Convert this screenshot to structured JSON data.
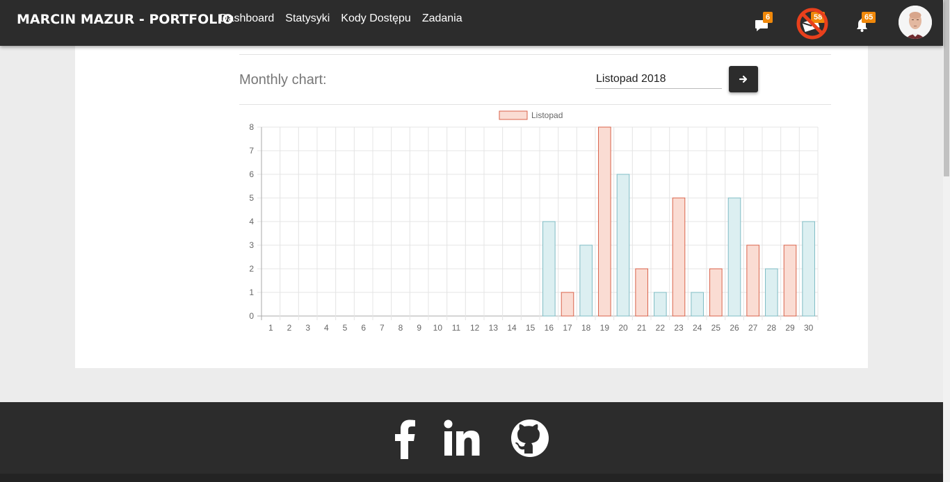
{
  "navbar": {
    "brand": "MARCIN MAZUR - PORTFOLIO",
    "links": [
      "Dashboard",
      "Statysyki",
      "Kody Dostępu",
      "Zadania"
    ],
    "messages_badge": "6",
    "mail_badge": "58",
    "notifications_badge": "65",
    "badge_color": "#f0880a"
  },
  "content": {
    "section_title": "Monthly chart:",
    "month_value": "Listopad 2018",
    "go_button_icon": "arrow-right-icon"
  },
  "chart_data": {
    "type": "bar",
    "title": "",
    "legend": "Listopad",
    "legend_position": "top",
    "categories": [
      "1",
      "2",
      "3",
      "4",
      "5",
      "6",
      "7",
      "8",
      "9",
      "10",
      "11",
      "12",
      "13",
      "14",
      "15",
      "16",
      "17",
      "18",
      "19",
      "20",
      "21",
      "22",
      "23",
      "24",
      "25",
      "26",
      "27",
      "28",
      "29",
      "30"
    ],
    "values": [
      0,
      0,
      0,
      0,
      0,
      0,
      0,
      0,
      0,
      0,
      0,
      0,
      0,
      0,
      0,
      4,
      1,
      3,
      8,
      6,
      2,
      1,
      5,
      1,
      2,
      5,
      3,
      2,
      3,
      4
    ],
    "ylim": [
      0,
      8
    ],
    "yticks": [
      "0",
      "1",
      "2",
      "3",
      "4",
      "5",
      "6",
      "7",
      "8"
    ],
    "grid": true,
    "colors": {
      "odd_fill": "#fadcd3",
      "odd_stroke": "#d9624a",
      "even_fill": "#dceff1",
      "even_stroke": "#7fbcc5",
      "grid": "#e4e4e4",
      "axis": "#aaaaaa",
      "tick_text": "#666666"
    }
  },
  "footer": {
    "icons": [
      "facebook-icon",
      "linkedin-icon",
      "github-icon"
    ]
  }
}
